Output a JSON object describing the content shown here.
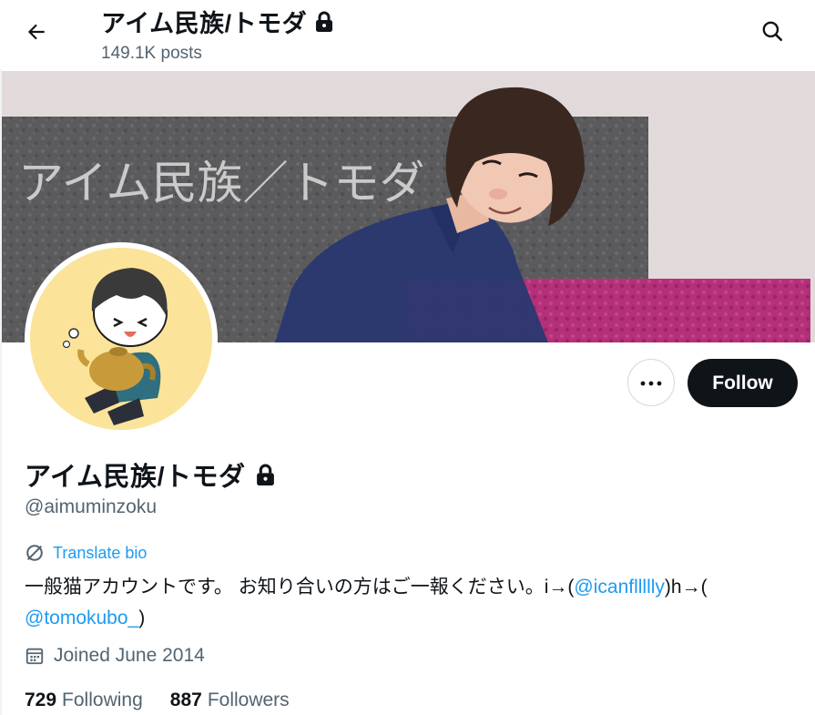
{
  "header": {
    "title": "アイム民族/トモダ",
    "post_count": "149.1K posts",
    "back_icon": "arrow-left-icon",
    "search_icon": "search-icon",
    "lock_icon": "lock-icon"
  },
  "banner": {
    "text": "アイム民族／トモダ"
  },
  "actions": {
    "more_icon": "more-dots-icon",
    "follow_label": "Follow"
  },
  "profile": {
    "display_name": "アイム民族/トモダ",
    "handle": "@aimuminzoku",
    "translate_label": "Translate bio",
    "bio": {
      "text_1": "一般猫アカウントです。 お知り合いの方はご一報ください。i→(",
      "mention_1": "@icanfllllly",
      "text_2": ")h→(",
      "mention_2": "@tomokubo_",
      "text_3": ")"
    },
    "joined": "Joined June 2014",
    "following_count": "729",
    "following_label": "Following",
    "followers_count": "887",
    "followers_label": "Followers"
  },
  "colors": {
    "accent": "#1d9bf0",
    "primary_text": "#0f1419",
    "secondary_text": "#536471",
    "follow_button_bg": "#0f1419"
  }
}
